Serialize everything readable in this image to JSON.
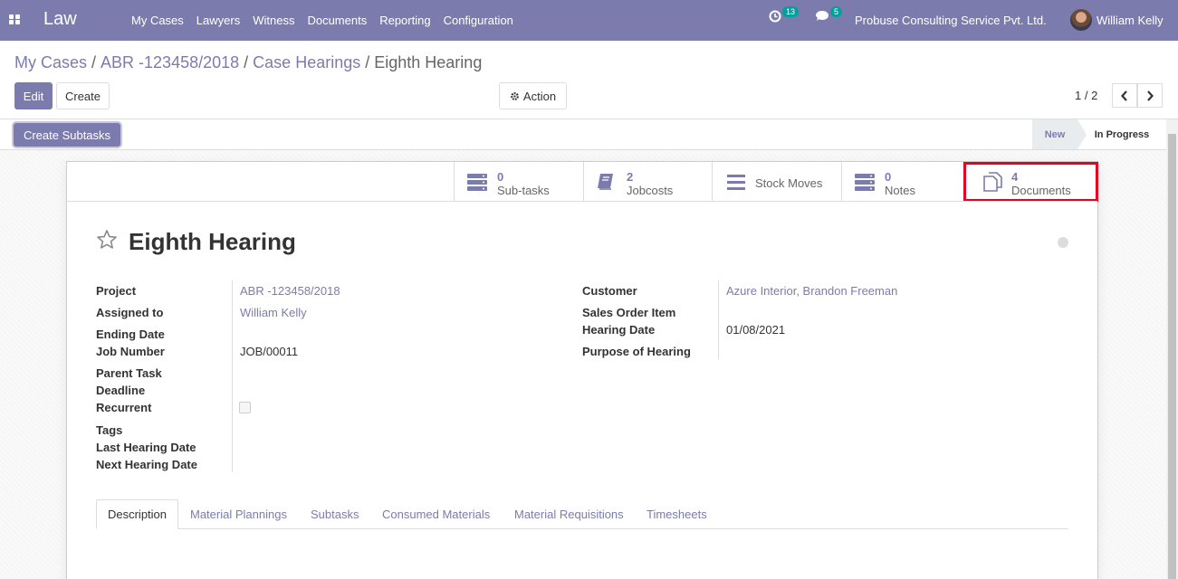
{
  "navbar": {
    "brand": "Law",
    "menu": [
      "My Cases",
      "Lawyers",
      "Witness",
      "Documents",
      "Reporting",
      "Configuration"
    ],
    "activity_count": "13",
    "message_count": "5",
    "company": "Probuse Consulting Service Pvt. Ltd.",
    "user": "William Kelly"
  },
  "breadcrumb": {
    "items": [
      "My Cases",
      "ABR -123458/2018",
      "Case Hearings"
    ],
    "current": "Eighth Hearing"
  },
  "toolbar": {
    "edit_label": "Edit",
    "create_label": "Create",
    "action_label": "Action",
    "pager": "1 / 2"
  },
  "statusbar": {
    "create_subtasks_label": "Create Subtasks",
    "stages": [
      "New",
      "In Progress"
    ],
    "current_stage": "In Progress"
  },
  "smart_buttons": [
    {
      "value": "0",
      "label": "Sub-tasks"
    },
    {
      "value": "2",
      "label": "Jobcosts"
    },
    {
      "value": "",
      "label": "Stock Moves"
    },
    {
      "value": "0",
      "label": "Notes"
    },
    {
      "value": "4",
      "label": "Documents"
    }
  ],
  "record": {
    "title": "Eighth Hearing",
    "left_fields": [
      {
        "label": "Project",
        "value": "ABR -123458/2018"
      },
      {
        "label": "Assigned to",
        "value": "William Kelly"
      },
      {
        "label": "Ending Date",
        "value": ""
      },
      {
        "label": "Job Number",
        "value": "JOB/00011"
      },
      {
        "label": "Parent Task",
        "value": ""
      },
      {
        "label": "Deadline",
        "value": ""
      },
      {
        "label": "Recurrent",
        "value": ""
      },
      {
        "label": "Tags",
        "value": ""
      },
      {
        "label": "Last Hearing Date",
        "value": ""
      },
      {
        "label": "Next Hearing Date",
        "value": ""
      }
    ],
    "right_fields": [
      {
        "label": "Customer",
        "value": "Azure Interior, Brandon Freeman"
      },
      {
        "label": "Sales Order Item",
        "value": ""
      },
      {
        "label": "Hearing Date",
        "value": "01/08/2021"
      },
      {
        "label": "Purpose of Hearing",
        "value": ""
      }
    ]
  },
  "tabs": [
    "Description",
    "Material Plannings",
    "Subtasks",
    "Consumed Materials",
    "Material Requisitions",
    "Timesheets"
  ],
  "colors": {
    "brand": "#7c7bad",
    "highlight": "#e8001c"
  }
}
